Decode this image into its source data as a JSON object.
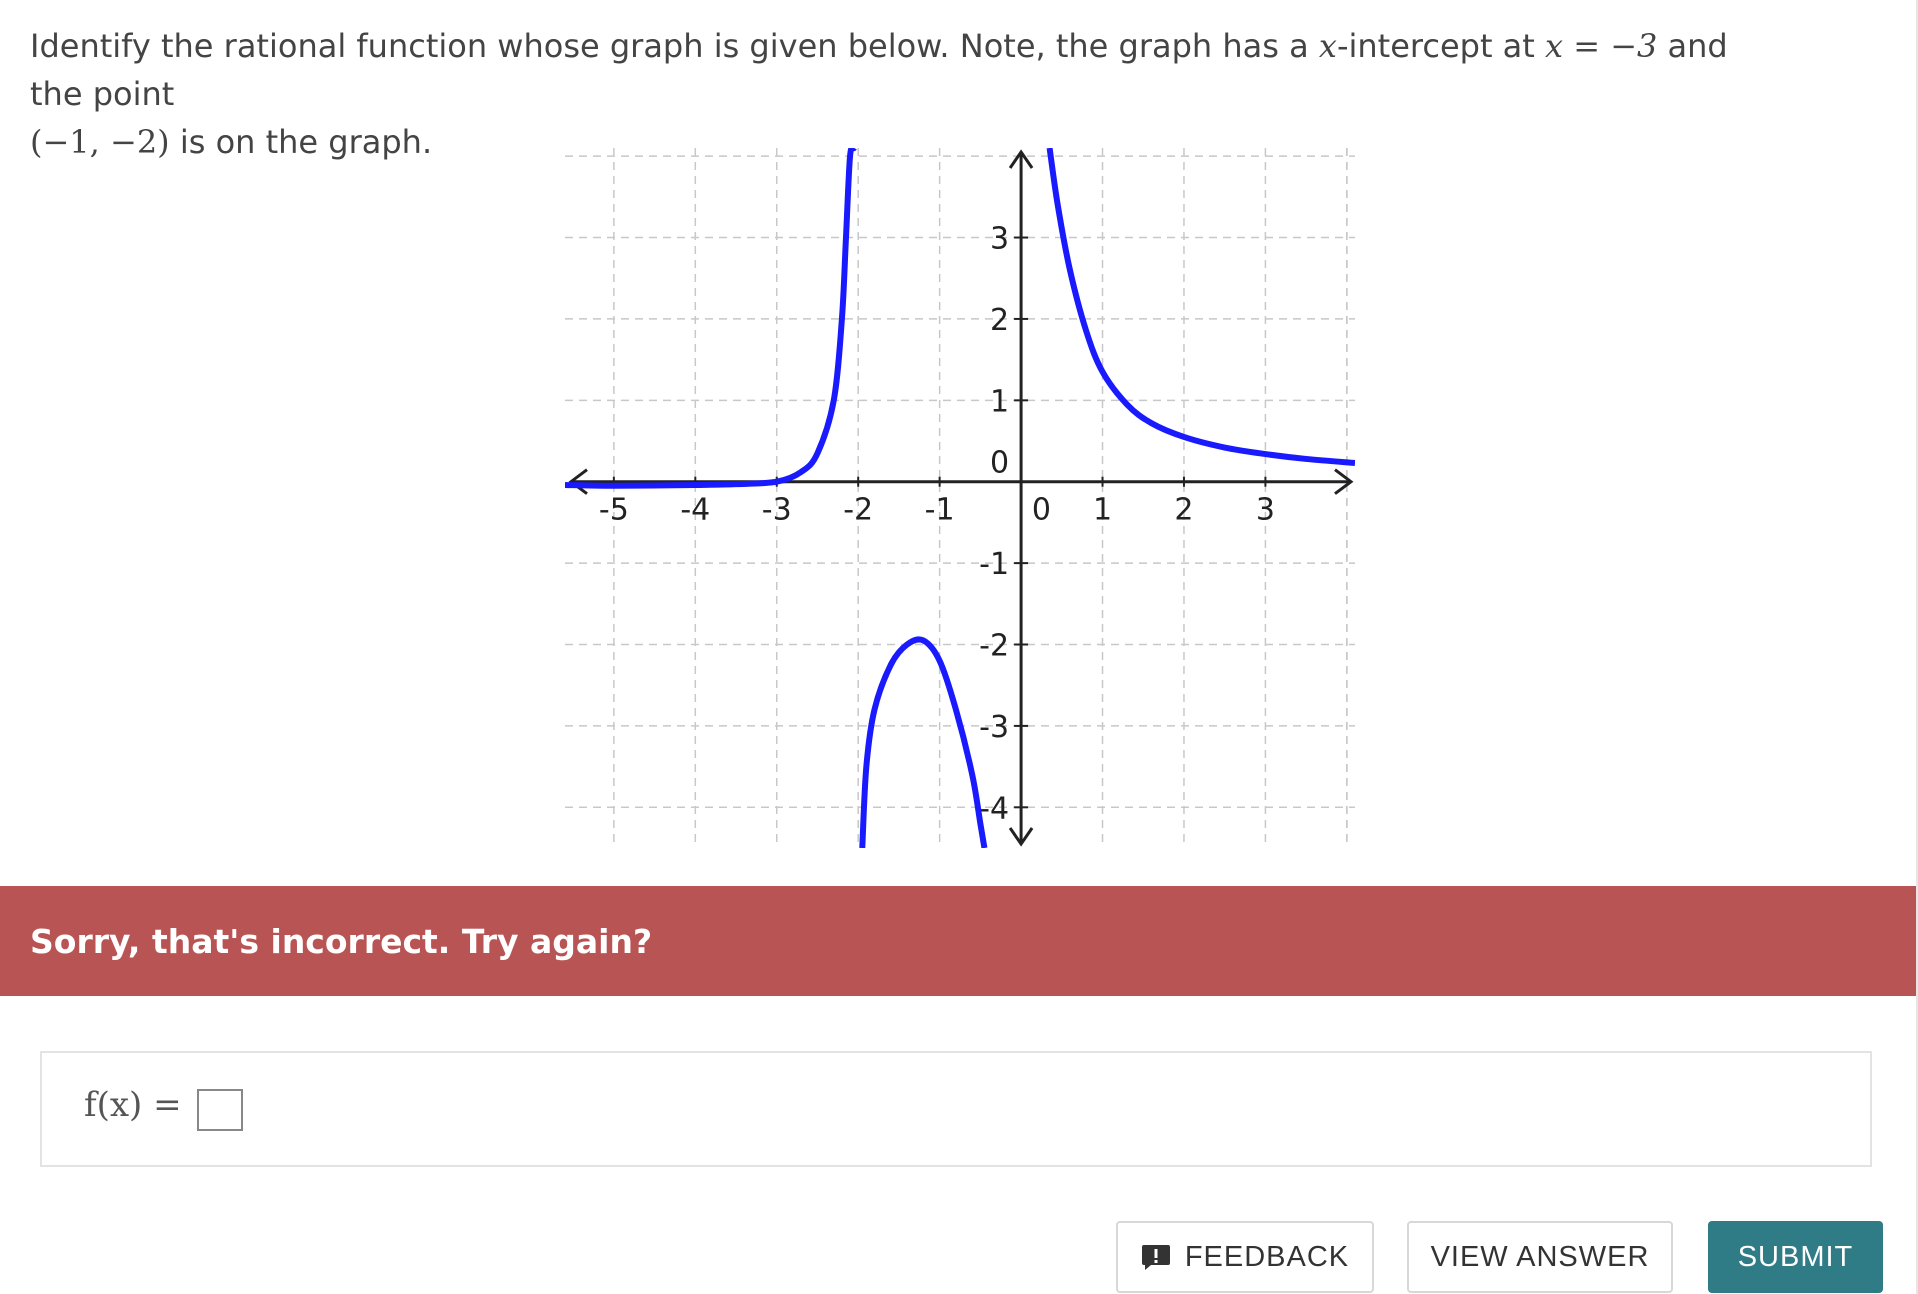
{
  "question": {
    "part1": "Identify the rational function whose graph is given below. Note, the graph has a ",
    "x_var": "x",
    "part2": "-intercept at ",
    "eq": "x = −3",
    "part3": " and the point",
    "point": "(−1, −2)",
    "part4": " is on the graph."
  },
  "chart_data": {
    "type": "line",
    "xlim": [
      -5.6,
      4.1
    ],
    "ylim": [
      -4.5,
      4.1
    ],
    "grid": true,
    "x_ticks": [
      "-5",
      "-4",
      "-3",
      "-2",
      "-1",
      "0",
      "1",
      "2",
      "3"
    ],
    "y_ticks_pos": [
      "3",
      "2",
      "1",
      "0"
    ],
    "y_ticks_neg": [
      "-1",
      "-2",
      "-3",
      "-4"
    ],
    "curve_color": "#1a1aff",
    "branches": [
      {
        "x": [
          -5.6,
          -5,
          -4,
          -3.5,
          -3,
          -2.7,
          -2.5,
          -2.3,
          -2.2,
          -2.15,
          -2.1,
          -2.05
        ],
        "y": [
          -0.04,
          -0.05,
          -0.04,
          -0.03,
          0,
          0.12,
          0.35,
          1.0,
          2.0,
          3.0,
          4.0,
          4.1
        ]
      },
      {
        "x": [
          -1.95,
          -1.9,
          -1.8,
          -1.6,
          -1.4,
          -1.2,
          -1.0,
          -0.8,
          -0.6,
          -0.5,
          -0.45
        ],
        "y": [
          -4.5,
          -3.5,
          -2.8,
          -2.25,
          -2.0,
          -1.95,
          -2.2,
          -2.8,
          -3.6,
          -4.2,
          -4.5
        ]
      },
      {
        "x": [
          0.35,
          0.45,
          0.6,
          0.8,
          1.0,
          1.3,
          1.6,
          2.0,
          2.5,
          3.0,
          3.5,
          4.1
        ],
        "y": [
          4.1,
          3.4,
          2.6,
          1.85,
          1.35,
          0.95,
          0.72,
          0.55,
          0.42,
          0.34,
          0.28,
          0.23
        ]
      }
    ]
  },
  "feedback_banner": {
    "text": "Sorry, that's incorrect. Try again?",
    "color": "#b95454"
  },
  "answer": {
    "label": "f(x) =",
    "value": ""
  },
  "buttons": {
    "feedback": "FEEDBACK",
    "feedback_icon": "exclamation-speech-icon",
    "view_answer": "VIEW ANSWER",
    "submit": "SUBMIT",
    "submit_color": "#2f7c87"
  }
}
